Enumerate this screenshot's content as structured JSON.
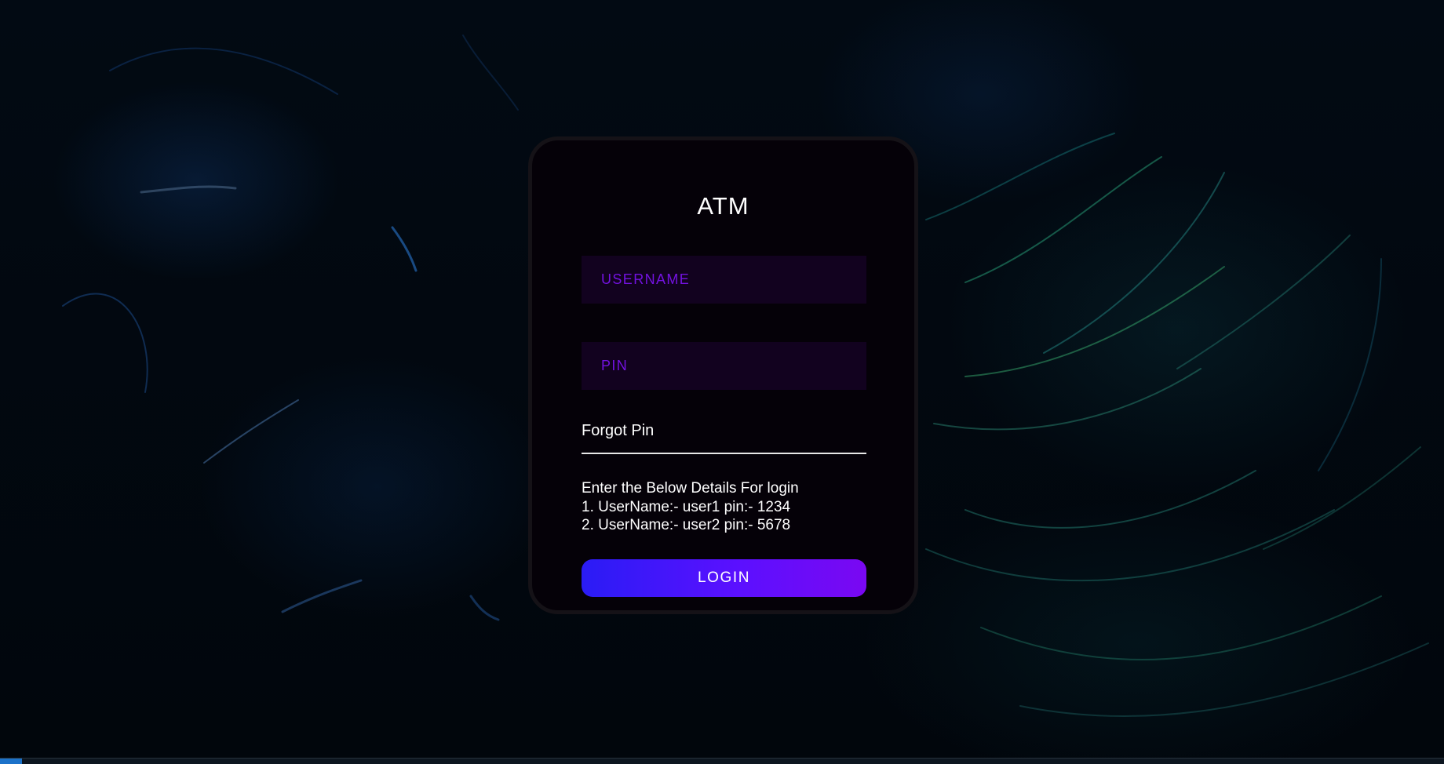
{
  "app": {
    "title": "ATM"
  },
  "form": {
    "username_placeholder": "USERNAME",
    "username_value": "",
    "pin_placeholder": "PIN",
    "pin_value": "",
    "forgot_label": "Forgot Pin",
    "info_lines": [
      "Enter the Below Details For login",
      "1. UserName:- user1 pin:- 1234",
      "2. UserName:- user2 pin:- 5678"
    ],
    "login_label": "LOGIN"
  },
  "colors": {
    "accent": "#7312e0",
    "button_start": "#2a1cf5",
    "button_end": "#7a08f2",
    "card_bg": "#050108",
    "input_bg": "#12021f"
  }
}
